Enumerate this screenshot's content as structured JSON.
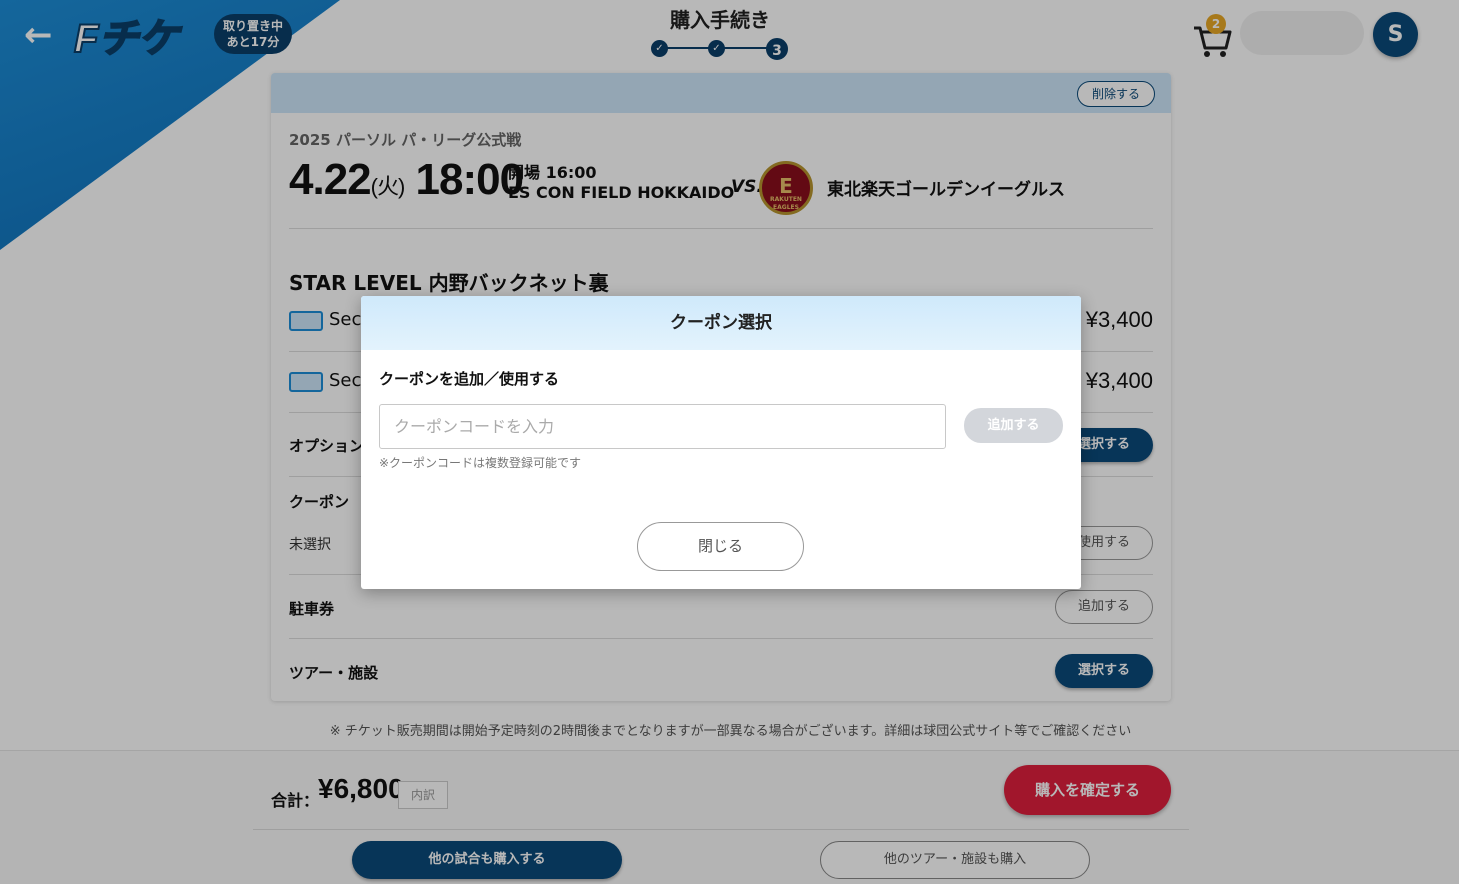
{
  "header": {
    "back_icon": "arrow-left-icon",
    "logo_text": "Fチケ",
    "timer_line1": "取り置き中",
    "timer_line2": "あと17分",
    "steps_title": "購入手続き",
    "current_step": "3",
    "cart_count": "2",
    "avatar_initial": "S"
  },
  "event": {
    "delete_label": "削除する",
    "league": "2025 パーソル パ・リーグ公式戦",
    "date": "4.22",
    "day_of_week": "(火)",
    "time": "18:00",
    "gate_open": "開場 16:00",
    "venue": "ES CON FIELD HOKKAIDO",
    "vs": "VS.",
    "team_logo_text": "RAKUTEN EAGLES",
    "opponent": "東北楽天ゴールデンイーグルス"
  },
  "seat": {
    "title": "STAR LEVEL 内野バックネット裏",
    "tickets": [
      {
        "label": "Sec",
        "price": "¥3,400"
      },
      {
        "label": "Sec",
        "price": "¥3,400"
      }
    ]
  },
  "options": {
    "option_label": "オプション",
    "option_button": "選択する",
    "coupon_label": "クーポン",
    "coupon_status": "未選択",
    "coupon_button": "使用する",
    "parking_label": "駐車券",
    "parking_button": "追加する",
    "tour_label": "ツアー・施設",
    "tour_button": "選択する"
  },
  "notice": "※ チケット販売期間は開始予定時刻の2時間後までとなりますが一部異なる場合がございます。詳細は球団公式サイト等でご確認ください",
  "footer": {
    "total_label": "合計：",
    "total_amount": "¥6,800",
    "breakdown_label": "内訳",
    "confirm_label": "購入を確定する",
    "more_games_label": "他の試合も購入する",
    "more_tours_label": "他のツアー・施設も購入"
  },
  "modal": {
    "title": "クーポン選択",
    "subtitle": "クーポンを追加／使用する",
    "input_placeholder": "クーポンコードを入力",
    "input_value": "",
    "add_label": "追加する",
    "note": "※クーポンコードは複数登録可能です",
    "close_label": "閉じる"
  },
  "colors": {
    "brand_navy": "#0b4a7a",
    "brand_blue": "#1d8ed8",
    "confirm_red": "#e01f3d"
  }
}
